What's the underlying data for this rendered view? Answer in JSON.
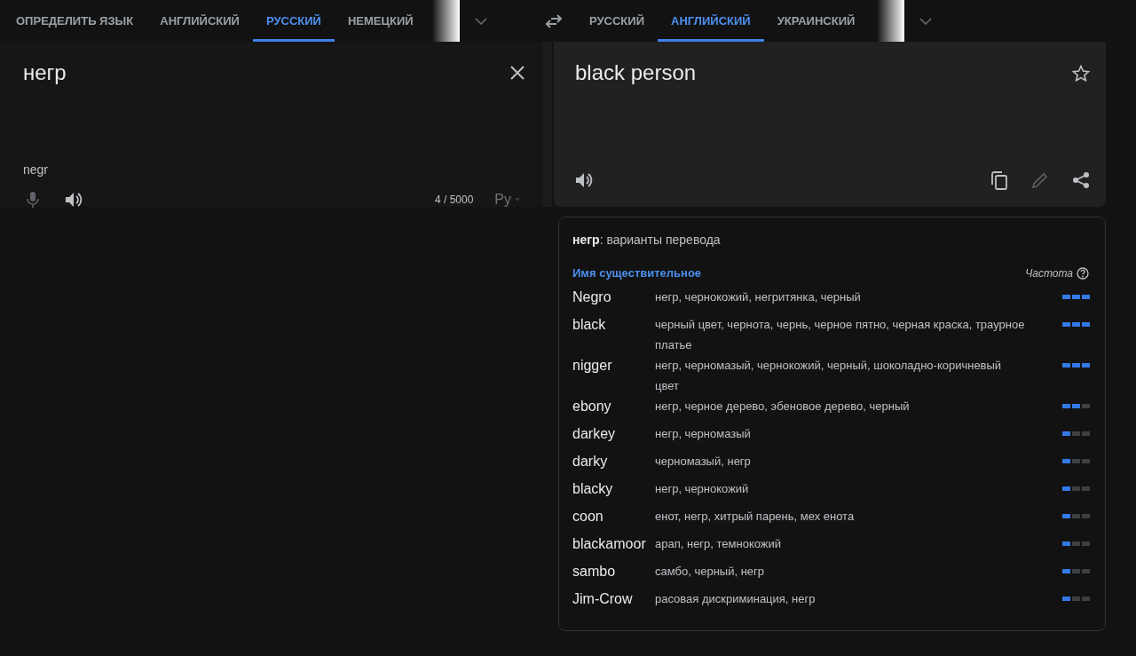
{
  "source_tabs": [
    {
      "label": "ОПРЕДЕЛИТЬ ЯЗЫК",
      "selected": false
    },
    {
      "label": "АНГЛИЙСКИЙ",
      "selected": false
    },
    {
      "label": "РУССКИЙ",
      "selected": true
    },
    {
      "label": "НЕМЕЦКИЙ",
      "selected": false
    }
  ],
  "target_tabs": [
    {
      "label": "РУССКИЙ",
      "selected": false
    },
    {
      "label": "АНГЛИЙСКИЙ",
      "selected": true
    },
    {
      "label": "УКРАИНСКИЙ",
      "selected": false
    }
  ],
  "source": {
    "text": "негр",
    "transliteration": "negr",
    "char_count": "4 / 5000",
    "input_tool": "Ру"
  },
  "target": {
    "text": "black person"
  },
  "dictionary": {
    "heading": "**негр**: варианты перевода",
    "part_of_speech": "Имя существительное",
    "frequency_label": "Частота",
    "entries": [
      {
        "word": "Negro",
        "translations": "негр, чернокожий, негритянка, черный",
        "level": 1
      },
      {
        "word": "black",
        "translations": "черный цвет, чернота, чернь, черное пятно, черная краска, траурное платье",
        "level": 1
      },
      {
        "word": "nigger",
        "translations": "негр, черномазый, чернокожий, черный, шоколадно-коричневый цвет",
        "level": 1
      },
      {
        "word": "ebony",
        "translations": "негр, черное дерево, эбеновое дерево, черный",
        "level": 0.67
      },
      {
        "word": "darkey",
        "translations": "негр, черномазый",
        "level": 0.33
      },
      {
        "word": "darky",
        "translations": "черномазый, негр",
        "level": 0.33
      },
      {
        "word": "blacky",
        "translations": "негр, чернокожий",
        "level": 0.33
      },
      {
        "word": "coon",
        "translations": "енот, негр, хитрый парень, мех енота",
        "level": 0.33
      },
      {
        "word": "blackamoor",
        "translations": "арап, негр, темнокожий",
        "level": 0.33
      },
      {
        "word": "sambo",
        "translations": "самбо, черный, негр",
        "level": 0.33
      },
      {
        "word": "Jim-Crow",
        "translations": "расовая дискриминация, негр",
        "level": 0.33
      }
    ]
  }
}
